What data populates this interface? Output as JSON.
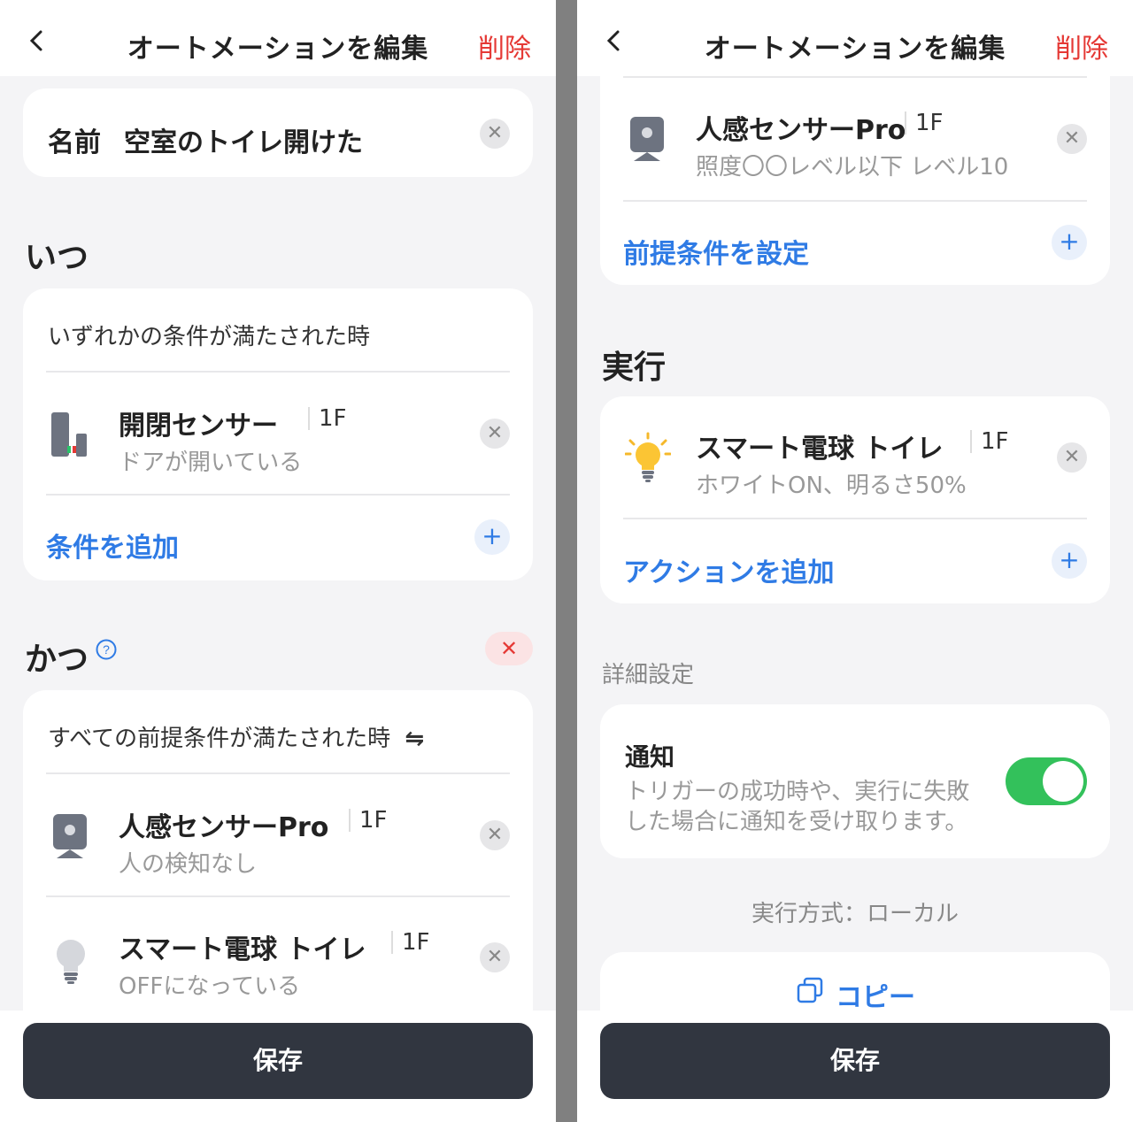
{
  "header": {
    "title": "オートメーションを編集",
    "delete_label": "削除"
  },
  "left": {
    "name_label": "名前",
    "name_value": "空室のトイレ開けた",
    "when_title": "いつ",
    "when_condition": "いずれかの条件が満たされた時",
    "when_items": [
      {
        "name": "開閉センサー",
        "floor": "1F",
        "sub": "ドアが開いている",
        "icon": "contact-sensor-icon"
      }
    ],
    "add_condition": "条件を追加",
    "and_title": "かつ",
    "and_condition": "すべての前提条件が満たされた時",
    "and_condition_icon": "swap-icon",
    "and_items": [
      {
        "name": "人感センサーPro",
        "floor": "1F",
        "sub": "人の検知なし",
        "icon": "motion-sensor-icon"
      },
      {
        "name": "スマート電球 トイレ",
        "floor": "1F",
        "sub": "OFFになっている",
        "icon": "bulb-off-icon"
      }
    ]
  },
  "right": {
    "pre_item": {
      "name": "人感センサーPro",
      "floor": "1F",
      "sub": "照度〇〇レベル以下 レベル10",
      "icon": "motion-sensor-icon"
    },
    "add_precondition": "前提条件を設定",
    "run_title": "実行",
    "run_item": {
      "name": "スマート電球 トイレ",
      "floor": "1F",
      "sub": "ホワイトON、明るさ50%",
      "icon": "bulb-on-icon"
    },
    "add_action": "アクションを追加",
    "advanced_title": "詳細設定",
    "notify_title": "通知",
    "notify_desc_1": "トリガーの成功時や、実行に失敗",
    "notify_desc_2": "した場合に通知を受け取ります。",
    "notify_on": true,
    "exec_mode": "実行方式：ローカル",
    "copy_label": "コピー"
  },
  "save_label": "保存",
  "colors": {
    "accent": "#2f7be5",
    "danger": "#e53935",
    "toggle_on": "#33c15b",
    "save_bg": "#313640"
  }
}
